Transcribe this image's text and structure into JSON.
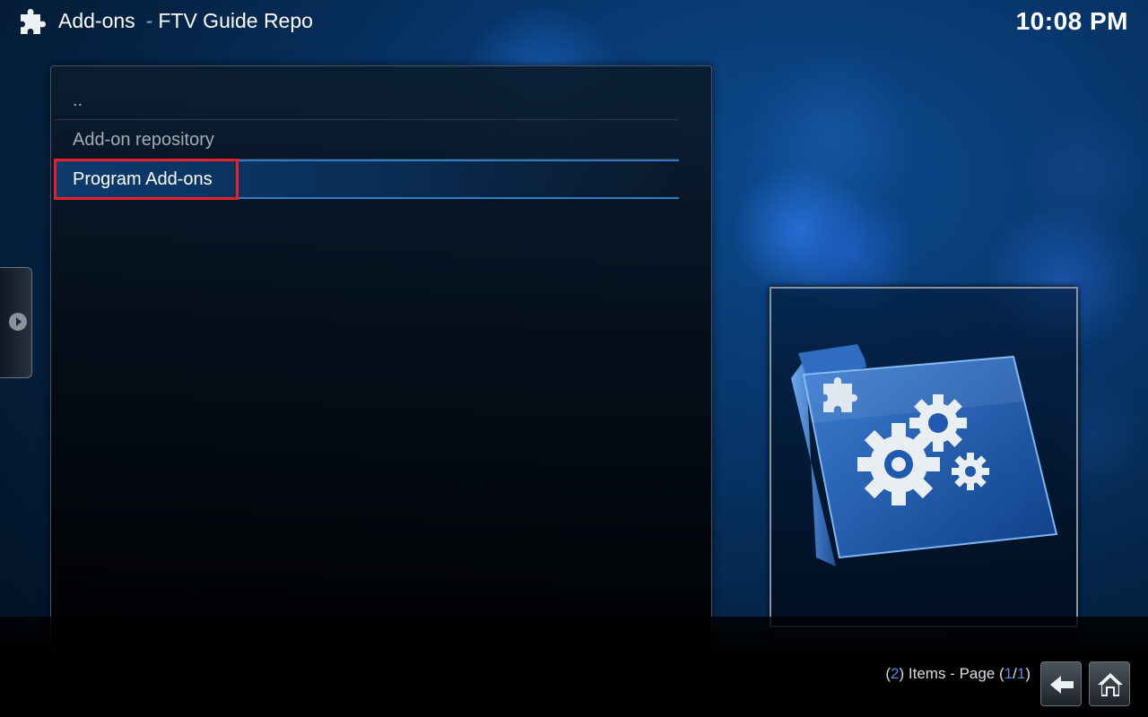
{
  "header": {
    "section_title": "Add-ons",
    "separator": "-",
    "subtitle": "FTV Guide Repo",
    "clock": "10:08 PM",
    "section_icon": "puzzle-icon"
  },
  "list": {
    "items": [
      {
        "label": "..",
        "focused": false
      },
      {
        "label": "Add-on repository",
        "focused": false
      },
      {
        "label": "Program Add-ons",
        "focused": true
      }
    ]
  },
  "side_tab": {
    "icon": "play-arrow-icon"
  },
  "thumbnail": {
    "icon": "program-addons-folder-icon"
  },
  "footer": {
    "items_open": "(",
    "items_count": "2",
    "items_mid": ") Items - Page (",
    "page_current": "1",
    "page_slash": "/",
    "page_total": "1",
    "items_close": ")",
    "back_icon": "back-arrow-icon",
    "home_icon": "home-icon"
  },
  "colors": {
    "accent": "#4a8ee0",
    "focus_bar": "#0c3b6e",
    "highlight": "#e8202a"
  }
}
